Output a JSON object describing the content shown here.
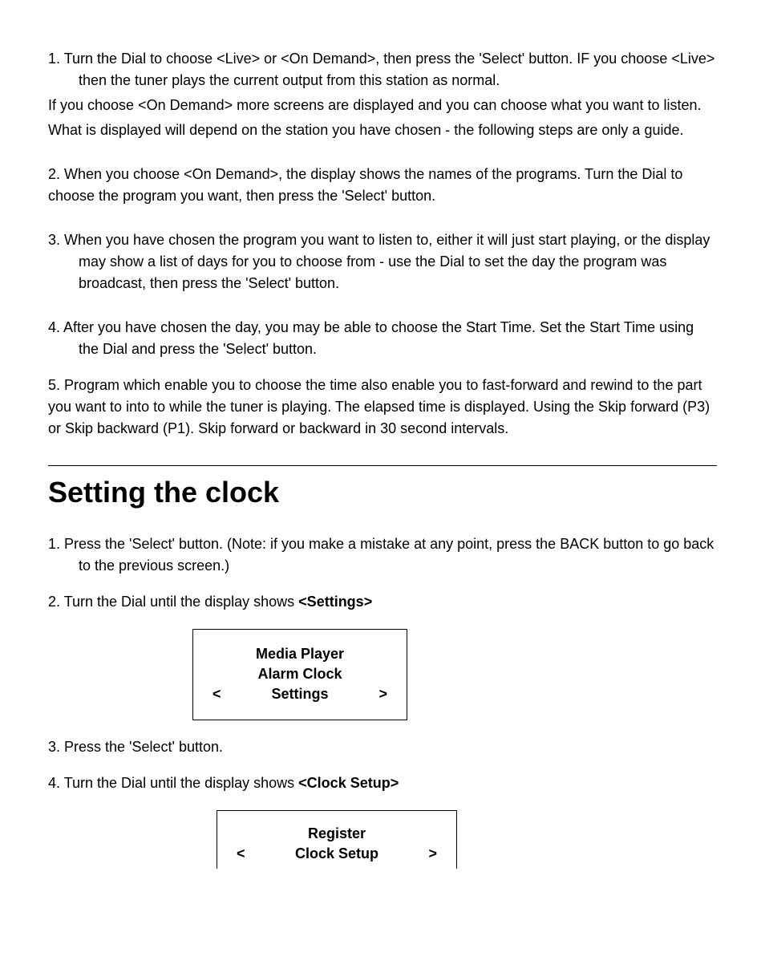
{
  "steps1": {
    "s1a": "1.  Turn the Dial to choose <Live> or <On Demand>, then press the 'Select' button.  IF you choose <Live> then the tuner plays the current output from this station as normal.",
    "s1b": "If you choose <On Demand> more screens are displayed and you can choose what you want to listen.",
    "s1c": "What is displayed will depend on the station you have chosen - the following steps are only a guide.",
    "s2": "2. When you choose <On Demand>, the display shows the names of the programs. Turn the Dial to choose the program you want, then press the 'Select' button.",
    "s3": "3.  When you have chosen the program you want to listen to, either it will just start playing, or the display may show a list of days for you to choose from - use the Dial to set the day the program was broadcast, then press the 'Select' button.",
    "s4": "4.  After you have chosen the day, you may be able to choose the Start Time. Set the Start Time using the Dial and press the 'Select' button.",
    "s5": "5.  Program which enable you to choose the time also enable you to fast-forward and rewind to the part you want to into to while the tuner is playing.  The elapsed time is displayed.  Using the Skip forward (P3) or Skip backward (P1).  Skip forward or backward in 30 second intervals."
  },
  "heading": "Setting the clock",
  "steps2": {
    "s1": "1.  Press the 'Select' button. (Note: if you make a mistake at any point, press the BACK button to go back to the previous screen.)",
    "s2_pre": "2. Turn the Dial until the display shows ",
    "s2_bold": "<Settings>",
    "s3": "3.  Press the 'Select' button.",
    "s4_pre": "4. Turn the Dial until the display shows ",
    "s4_bold": "<Clock Setup>"
  },
  "display1": {
    "line1": "Media Player",
    "line2": "Alarm Clock",
    "left": "<",
    "selected": "Settings",
    "right": ">"
  },
  "display2": {
    "line1": "Register",
    "left": "<",
    "selected": "Clock Setup",
    "right": ">"
  }
}
